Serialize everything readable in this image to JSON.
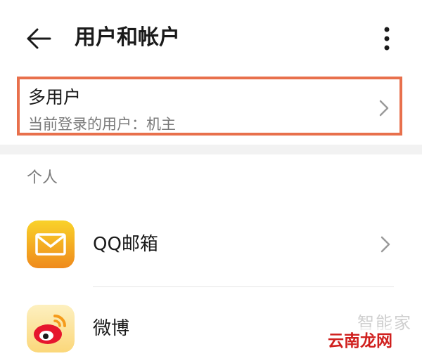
{
  "header": {
    "title": "用户和帐户",
    "back_icon": "arrow-left-icon",
    "more_icon": "more-vertical-icon"
  },
  "multi_user": {
    "title": "多用户",
    "subtitle": "当前登录的用户：机主",
    "highlight_color": "#e8704c"
  },
  "section": {
    "personal_label": "个人"
  },
  "accounts": [
    {
      "label": "QQ邮箱",
      "icon": "qq-mail-icon",
      "has_chevron": true
    },
    {
      "label": "微博",
      "icon": "weibo-icon",
      "has_chevron": false
    }
  ],
  "watermark": {
    "top_text": "智能家",
    "bottom_text": "云南龙网"
  },
  "colors": {
    "qq_mail_gradient_top": "#f7c51e",
    "qq_mail_gradient_bottom": "#f08a1c",
    "weibo_red": "#e6162d",
    "weibo_orange": "#f59b1b",
    "weibo_bg": "#fde7a3"
  }
}
